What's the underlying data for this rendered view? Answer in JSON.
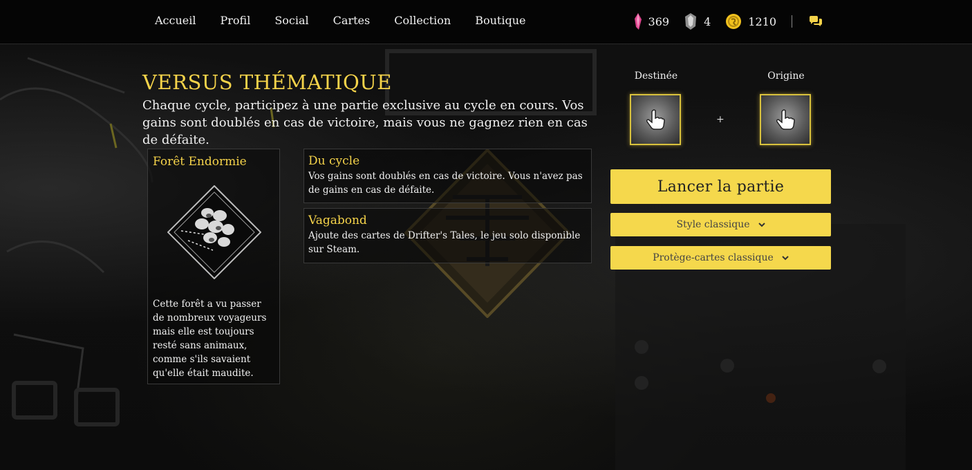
{
  "nav": {
    "items": [
      "Accueil",
      "Profil",
      "Social",
      "Cartes",
      "Collection",
      "Boutique"
    ]
  },
  "currencies": {
    "crystal": "369",
    "shard": "4",
    "gold": "1210"
  },
  "colors": {
    "accent": "#f5d34a",
    "button": "#f5d84c",
    "background": "#0b0b0b"
  },
  "header": {
    "title": "VERSUS THÉMATIQUE",
    "intro": "Chaque cycle, participez à une partie exclusive au cycle en cours. Vos gains sont doublés en cas de victoire, mais vous ne gagnez rien en cas de défaite."
  },
  "theme_card": {
    "name": "Forêt Endormie",
    "description": "Cette forêt a vu passer de nombreux voyageurs mais elle est toujours resté sans animaux, comme s'ils savaient qu'elle était maudite."
  },
  "modifiers": [
    {
      "title": "Du cycle",
      "description": "Vos gains sont doublés en cas de victoire. Vous n'avez pas de gains en cas de défaite."
    },
    {
      "title": "Vagabond",
      "description": "Ajoute des cartes de Drifter's Tales, le jeu solo disponible sur Steam."
    }
  ],
  "deck": {
    "destiny_label": "Destinée",
    "origin_label": "Origine",
    "plus": "+"
  },
  "actions": {
    "launch": "Lancer la partie",
    "style": "Style classique",
    "sleeves": "Protège-cartes classique"
  },
  "icons": {
    "crystal": "pink-crystal-icon",
    "shard": "silver-shard-icon",
    "gold": "gold-coin-icon",
    "chat": "chat-bubbles-icon",
    "pointer": "hand-pointer-icon",
    "chevron": "chevron-down-icon"
  }
}
